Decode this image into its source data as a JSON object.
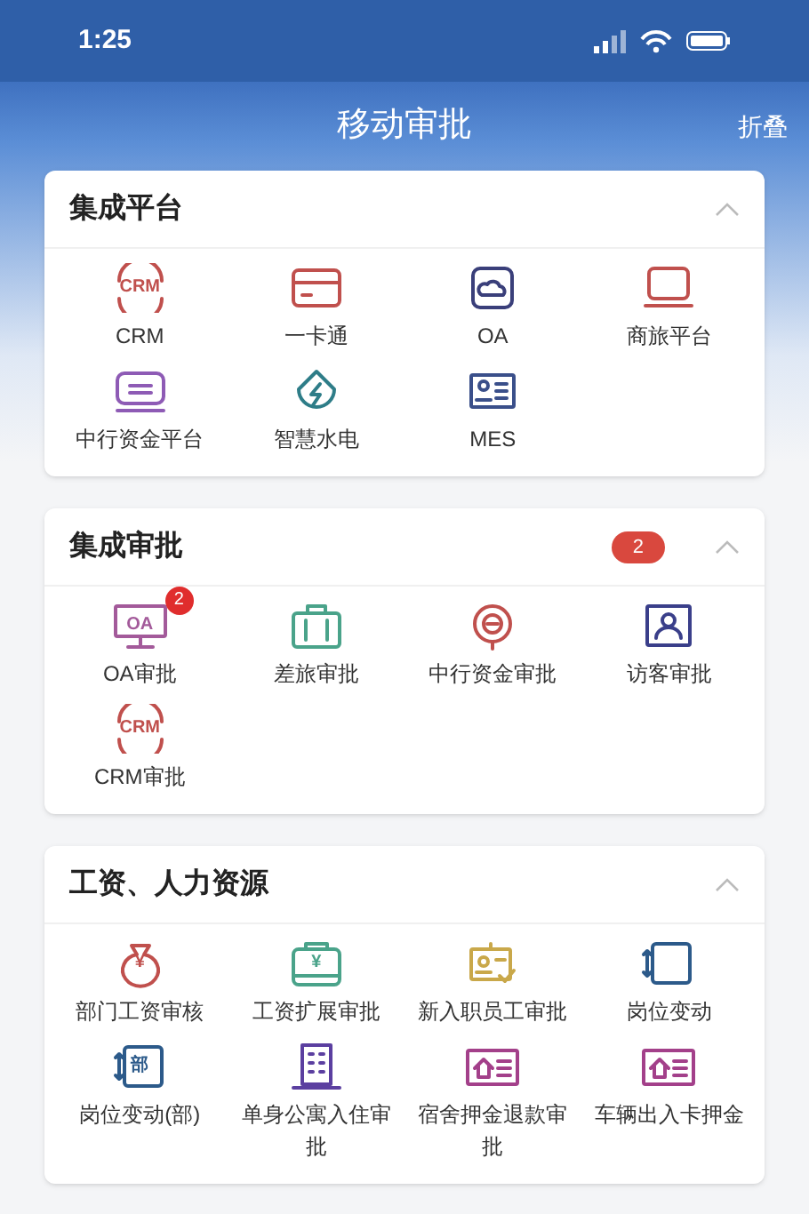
{
  "status_bar": {
    "time": "1:25"
  },
  "header": {
    "title": "移动审批",
    "action": "折叠"
  },
  "sections": [
    {
      "title": "集成平台",
      "expanded": true,
      "items": [
        {
          "label": "CRM",
          "kind": "crm",
          "glyph": "CRM",
          "color": "#c0504d"
        },
        {
          "label": "一卡通",
          "kind": "card",
          "color": "#c0504d"
        },
        {
          "label": "OA",
          "kind": "cloud",
          "color": "#3a3f7a"
        },
        {
          "label": "商旅平台",
          "kind": "laptop",
          "color": "#c0504d"
        },
        {
          "label": "中行资金平台",
          "kind": "message",
          "color": "#8e5bb5"
        },
        {
          "label": "智慧水电",
          "kind": "bolt",
          "color": "#2e7d88"
        },
        {
          "label": "MES",
          "kind": "idcard",
          "color": "#3a4f8a"
        }
      ]
    },
    {
      "title": "集成审批",
      "expanded": true,
      "badge": "2",
      "items": [
        {
          "label": "OA审批",
          "kind": "monitor",
          "glyph": "OA",
          "badge": "2",
          "color": "#a35a9a"
        },
        {
          "label": "差旅审批",
          "kind": "suitcase",
          "color": "#4aa38a"
        },
        {
          "label": "中行资金审批",
          "kind": "target",
          "color": "#c0504d"
        },
        {
          "label": "访客审批",
          "kind": "person",
          "color": "#3a3f8a"
        },
        {
          "label": "CRM审批",
          "kind": "crm",
          "glyph": "CRM",
          "color": "#c0504d"
        }
      ]
    },
    {
      "title": "工资、人力资源",
      "expanded": true,
      "items": [
        {
          "label": "部门工资审核",
          "kind": "moneybag",
          "glyph": "¥",
          "color": "#c0504d"
        },
        {
          "label": "工资扩展审批",
          "kind": "box",
          "glyph": "¥",
          "color": "#4aa38a"
        },
        {
          "label": "新入职员工审批",
          "kind": "badge",
          "color": "#c9a84a"
        },
        {
          "label": "岗位变动",
          "kind": "frame",
          "color": "#2c5a8a"
        },
        {
          "label": "岗位变动(部)",
          "kind": "frame",
          "glyph": "部",
          "color": "#2c5a8a"
        },
        {
          "label": "单身公寓入住审批",
          "kind": "building",
          "color": "#5b3fa0"
        },
        {
          "label": "宿舍押金退款审批",
          "kind": "house",
          "color": "#a3408a"
        },
        {
          "label": "车辆出入卡押金",
          "kind": "house",
          "color": "#a3408a"
        }
      ]
    }
  ]
}
